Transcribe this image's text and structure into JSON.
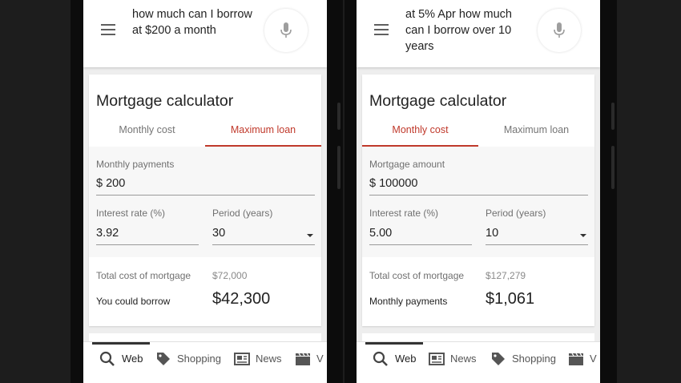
{
  "phones": [
    {
      "query": "how much can I borrow at $200 a month",
      "card_title": "Mortgage calculator",
      "tabs": [
        "Monthly cost",
        "Maximum loan"
      ],
      "active_tab": 1,
      "field1_label": "Monthly payments",
      "field1_value": "$ 200",
      "rate_label": "Interest rate (%)",
      "rate_value": "3.92",
      "period_label": "Period (years)",
      "period_value": "30",
      "total_label": "Total cost of mortgage",
      "total_value": "$72,000",
      "result_label": "You could borrow",
      "result_value": "$42,300",
      "nav": [
        "Web",
        "Shopping",
        "News",
        "V"
      ]
    },
    {
      "query": "at 5% Apr how much can I borrow over 10 years",
      "card_title": "Mortgage calculator",
      "tabs": [
        "Monthly cost",
        "Maximum loan"
      ],
      "active_tab": 0,
      "field1_label": "Mortgage amount",
      "field1_value": "$ 100000",
      "rate_label": "Interest rate (%)",
      "rate_value": "5.00",
      "period_label": "Period (years)",
      "period_value": "10",
      "total_label": "Total cost of mortgage",
      "total_value": "$127,279",
      "result_label": "Monthly payments",
      "result_value": "$1,061",
      "nav": [
        "Web",
        "News",
        "Shopping",
        "V"
      ]
    }
  ]
}
